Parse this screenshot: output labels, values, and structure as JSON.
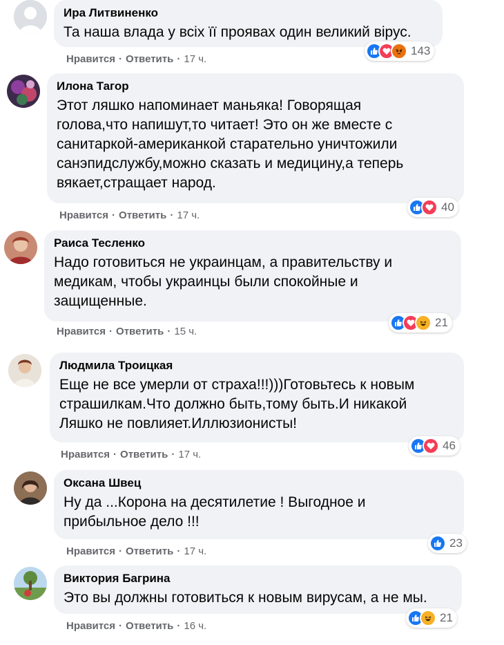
{
  "comments": [
    {
      "author": "Ира Литвиненко",
      "lines": [
        "Та наша влада у всіх її проявах один великий вірус."
      ],
      "like": "Нравится",
      "reply": "Ответить",
      "time": "17 ч.",
      "reactions": [
        "like-icon",
        "love-icon",
        "angry-icon"
      ],
      "reaction_count": "143",
      "avatar_color": "#dcdfe4"
    },
    {
      "author": "Илона Тагор",
      "lines": [
        "Этот ляшко напоминает маньяка! Говорящая",
        "голова,что напишут,то читает! Это он же вместе с",
        "санитаркой-американкой старательно уничтожили",
        "санэпидслужбу,можно сказать и медицину,а теперь",
        "вякает,стращает народ."
      ],
      "like": "Нравится",
      "reply": "Ответить",
      "time": "17 ч.",
      "reactions": [
        "like-icon",
        "love-icon"
      ],
      "reaction_count": "40",
      "avatar_color": "#7b3a8c"
    },
    {
      "author": "Раиса Тесленко",
      "lines": [
        "Надо готовиться не украинцам, а правительству и",
        "медикам, чтобы украинцы были спокойные и",
        "защищенные."
      ],
      "like": "Нравится",
      "reply": "Ответить",
      "time": "15 ч.",
      "reactions": [
        "like-icon",
        "love-icon",
        "haha-icon"
      ],
      "reaction_count": "21",
      "avatar_color": "#b44a3c"
    },
    {
      "author": "Людмила Троицкая",
      "lines": [
        "Еще не все умерли от страха!!!)))Готовьтесь к новым",
        "страшилкам.Что должно быть,тому быть.И никакой",
        "Ляшко не повлияет.Иллюзионисты!"
      ],
      "like": "Нравится",
      "reply": "Ответить",
      "time": "17 ч.",
      "reactions": [
        "like-icon",
        "love-icon"
      ],
      "reaction_count": "46",
      "avatar_color": "#c9a98a"
    },
    {
      "author": "Оксана Швец",
      "lines": [
        "Ну да ...Корона на десятилетие ! Выгодное и",
        "прибыльное дело !!!"
      ],
      "like": "Нравится",
      "reply": "Ответить",
      "time": "17 ч.",
      "reactions": [
        "like-icon"
      ],
      "reaction_count": "23",
      "avatar_color": "#5a3f33"
    },
    {
      "author": "Виктория Багрина",
      "lines": [
        "Это вы должны готовиться к новым вирусам, а не мы."
      ],
      "like": "Нравится",
      "reply": "Ответить",
      "time": "16 ч.",
      "reactions": [
        "like-icon",
        "haha-icon"
      ],
      "reaction_count": "21",
      "avatar_color": "#6f9c4c"
    }
  ]
}
